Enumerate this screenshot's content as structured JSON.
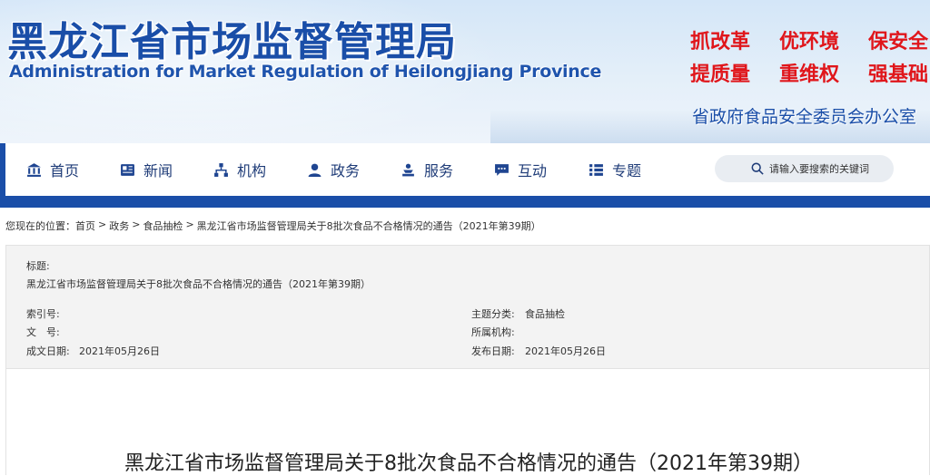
{
  "header": {
    "site_title": "黑龙江省市场监督管理局",
    "site_subtitle": "Administration for Market Regulation of Heilongjiang Province",
    "slogans": [
      "抓改革",
      "优环境",
      "保安全",
      "提质量",
      "重维权",
      "强基础"
    ],
    "office": "省政府食品安全委员会办公室",
    "colors": {
      "title": "#1a4ea8",
      "slogan": "#e0161b"
    }
  },
  "nav": {
    "items": [
      {
        "label": "首页",
        "icon": "bank-icon"
      },
      {
        "label": "新闻",
        "icon": "newspaper-icon"
      },
      {
        "label": "机构",
        "icon": "org-chart-icon"
      },
      {
        "label": "政务",
        "icon": "person-icon"
      },
      {
        "label": "服务",
        "icon": "service-icon"
      },
      {
        "label": "互动",
        "icon": "chat-icon"
      },
      {
        "label": "专题",
        "icon": "list-icon"
      }
    ],
    "search_placeholder": "请输入要搜索的关键词"
  },
  "breadcrumb": {
    "prefix": "您现在的位置：",
    "items": [
      "首页",
      "政务",
      "食品抽检",
      "黑龙江省市场监督管理局关于8批次食品不合格情况的通告（2021年第39期）"
    ],
    "separator": ">"
  },
  "meta": {
    "title_label": "标题:",
    "title_value": "黑龙江省市场监督管理局关于8批次食品不合格情况的通告（2021年第39期）",
    "index_label": "索引号:",
    "index_value": "",
    "doc_no_label": "文　号:",
    "doc_no_value": "",
    "created_label": "成文日期:",
    "created_value": "2021年05月26日",
    "category_label": "主题分类:",
    "category_value": "食品抽检",
    "org_label": "所属机构:",
    "org_value": "",
    "published_label": "发布日期:",
    "published_value": "2021年05月26日"
  },
  "article": {
    "title": "黑龙江省市场监督管理局关于8批次食品不合格情况的通告（2021年第39期）"
  }
}
